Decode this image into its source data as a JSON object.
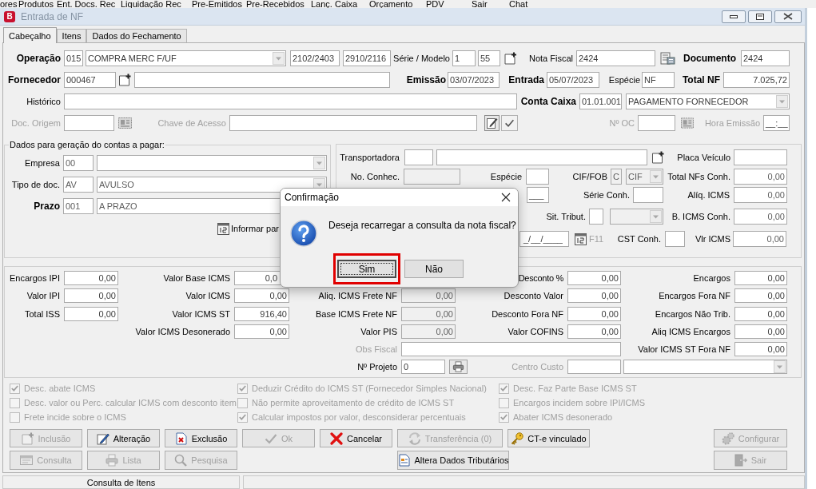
{
  "menu_bar": {
    "items": [
      "ores",
      "Produtos",
      "Ent. Docs. Rec",
      "Liquidação Rec",
      "Pre-Emitidos",
      "Pre-Recebidos",
      "Lanç. Caixa",
      "Orçamento",
      "PDV",
      "Sair",
      "Chat"
    ]
  },
  "window": {
    "app_badge": "B",
    "title": "Entrada de NF",
    "active": false
  },
  "tabs": [
    {
      "label": "Cabeçalho",
      "selected": true
    },
    {
      "label": "Itens",
      "selected": false
    },
    {
      "label": "Dados do Fechamento",
      "selected": false
    }
  ],
  "header": {
    "operation": {
      "label": "Operação",
      "code": "015",
      "name": "COMPRA MERC F/UF",
      "code_2": "2102/2403",
      "code_3": "2910/2116"
    },
    "series_model": {
      "label": "Série / Modelo",
      "series": "1",
      "model": "55"
    },
    "invoice_number": {
      "label": "Nota Fiscal",
      "value": "2424"
    },
    "document": {
      "label": "Documento",
      "value": "2424"
    },
    "supplier": {
      "label": "Fornecedor",
      "code": "000467"
    },
    "issue_date": {
      "label": "Emissão",
      "value": "03/07/2023"
    },
    "entry_date": {
      "label": "Entrada",
      "value": "05/07/2023"
    },
    "species": {
      "label": "Espécie",
      "value": "NF"
    },
    "total": {
      "label": "Total NF",
      "value": "7.025,72"
    },
    "history": {
      "label": "Histórico"
    },
    "cash_account": {
      "label": "Conta Caixa",
      "code": "01.01.001",
      "name": "PAGAMENTO FORNECEDOR"
    },
    "origin_doc": {
      "label": "Doc. Origem",
      "disabled": true
    },
    "access_key": {
      "label": "Chave de Acesso",
      "disabled": true
    },
    "purchase_order": {
      "label": "Nº OC",
      "disabled": true
    },
    "issue_time": {
      "label": "Hora Emissão",
      "value": "__:__",
      "disabled": true
    }
  },
  "payables": {
    "title": "Dados para geração do contas a pagar:",
    "company": {
      "label": "Empresa",
      "code": "00"
    },
    "document_type": {
      "label": "Tipo de doc.",
      "code": "AV",
      "name": "AVULSO"
    },
    "term": {
      "label": "Prazo",
      "code": "001",
      "name": "A PRAZO"
    },
    "installments_button": "Informar par"
  },
  "transport": {
    "carrier": {
      "label": "Transportadora"
    },
    "vehicle_plate": {
      "label": "Placa Veículo"
    },
    "bill_number": {
      "label": "No. Conhec.",
      "read_only": true
    },
    "species": {
      "label": "Espécie"
    },
    "freight_mode": {
      "label": "CIF/FOB",
      "code": "C",
      "name": "CIF",
      "read_only": true
    },
    "total_invoices": {
      "label": "Total NFs Conh.",
      "value": "0,00"
    },
    "field_1": {
      "value": "___"
    },
    "bill_series": {
      "label": "Série Conh."
    },
    "icms_rate": {
      "label": "Alíq. ICMS",
      "value": "0,00"
    },
    "tax_situation": {
      "label": "Sit. Tribut.",
      "read_only": true
    },
    "icms_base": {
      "label": "B. ICMS Conh.",
      "value": "0,00"
    },
    "date": {
      "value": "_/__/____"
    },
    "shortcut": {
      "label": "F11",
      "disabled": true
    },
    "cst": {
      "label": "CST Conh."
    },
    "icms_value": {
      "label": "Vlr ICMS",
      "value": "0,00"
    }
  },
  "totals": {
    "ipi_charges": {
      "label": "Encargos IPI",
      "value": "0,00"
    },
    "icms_base": {
      "label": "Valor Base ICMS",
      "value": "0,0"
    },
    "discount_percent": {
      "label": "Desconto %",
      "value": "0,00"
    },
    "charges": {
      "label": "Encargos",
      "value": "0,00"
    },
    "ipi_value": {
      "label": "Valor IPI",
      "value": "0,00"
    },
    "icms_value": {
      "label": "Valor ICMS",
      "value": "0,00"
    },
    "freight_icms_rate": {
      "label": "Aliq. ICMS Frete NF",
      "value": "0,00",
      "read_only": true
    },
    "discount_value": {
      "label": "Desconto Valor",
      "value": "0,00"
    },
    "charges_outside": {
      "label": "Encargos Fora NF",
      "value": "0,00"
    },
    "iss_total": {
      "label": "Total ISS",
      "value": "0,00"
    },
    "icms_st_value": {
      "label": "Valor ICMS ST",
      "value": "916,40"
    },
    "freight_icms_base": {
      "label": "Base ICMS Frete NF",
      "value": "0,00",
      "read_only": true
    },
    "discount_outside": {
      "label": "Desconto Fora NF",
      "value": "0,00"
    },
    "charges_untaxed": {
      "label": "Encargos Não Trib.",
      "value": "0,00"
    },
    "icms_exempted": {
      "label": "Valor ICMS Desonerado",
      "value": "0,00"
    },
    "pis_value": {
      "label": "Valor PIS",
      "value": "0,00",
      "read_only": true
    },
    "cofins_value": {
      "label": "Valor COFINS",
      "value": "0,00"
    },
    "charges_icms_rate": {
      "label": "Aliq ICMS Encargos",
      "value": "0,00"
    },
    "fiscal_notes": {
      "label": "Obs Fiscal",
      "disabled": true
    },
    "icms_st_outside": {
      "label": "Valor ICMS ST Fora NF",
      "value": "0,00"
    },
    "project": {
      "label": "Nº Projeto",
      "value": "0"
    },
    "cost_center": {
      "label": "Centro Custo",
      "disabled": true
    }
  },
  "options": [
    {
      "items": [
        {
          "label": "Desc. abate ICMS",
          "checked": true,
          "disabled": true
        },
        {
          "label": "Desc. valor ou Perc. calcular ICMS com desconto item",
          "checked": false,
          "disabled": true
        },
        {
          "label": "Frete incide sobre o ICMS",
          "checked": false,
          "disabled": true
        }
      ]
    },
    {
      "items": [
        {
          "label": "Deduzir Crédito do ICMS ST (Fornecedor Simples Nacional)",
          "checked": true,
          "disabled": true
        },
        {
          "label": "Não permite aproveitamento de crédito de ICMS ST",
          "checked": false,
          "disabled": true
        },
        {
          "label": "Calcular impostos por valor, desconsiderar percentuais",
          "checked": true,
          "disabled": true
        }
      ]
    },
    {
      "items": [
        {
          "label": "Desc. Faz Parte Base ICMS ST",
          "checked": true,
          "disabled": true
        },
        {
          "label": "Encargos incidem sobre IPI/ICMS",
          "checked": false,
          "disabled": true
        },
        {
          "label": "Abater ICMS desonerado",
          "checked": true,
          "disabled": true
        }
      ]
    }
  ],
  "buttons": {
    "row_1": [
      {
        "label": "Inclusão",
        "disabled": true
      },
      {
        "label": "Alteração",
        "disabled": false
      },
      {
        "label": "Exclusão",
        "disabled": false
      },
      {
        "label": "Ok",
        "disabled": true
      },
      {
        "label": "Cancelar",
        "disabled": false
      },
      {
        "label": "Transferência (0)",
        "disabled": true
      },
      {
        "label": "CT-e vinculado",
        "disabled": false
      },
      {
        "label": "Configurar",
        "disabled": true
      }
    ],
    "row_2": [
      {
        "label": "Consulta",
        "disabled": true
      },
      {
        "label": "Lista",
        "disabled": true
      },
      {
        "label": "Pesquisa",
        "disabled": true
      },
      {
        "label": "Altera Dados Tributários",
        "disabled": false
      },
      {
        "label": "Sair",
        "disabled": true
      }
    ]
  },
  "status_bar": {
    "panels": [
      "Consulta de Itens"
    ]
  },
  "dialog": {
    "title": "Confirmação",
    "message": "Deseja recarregar a consulta da nota fiscal?",
    "buttons": [
      {
        "label": "Sim",
        "focused": true,
        "highlighted": true
      },
      {
        "label": "Não",
        "focused": false,
        "highlighted": false
      }
    ]
  }
}
